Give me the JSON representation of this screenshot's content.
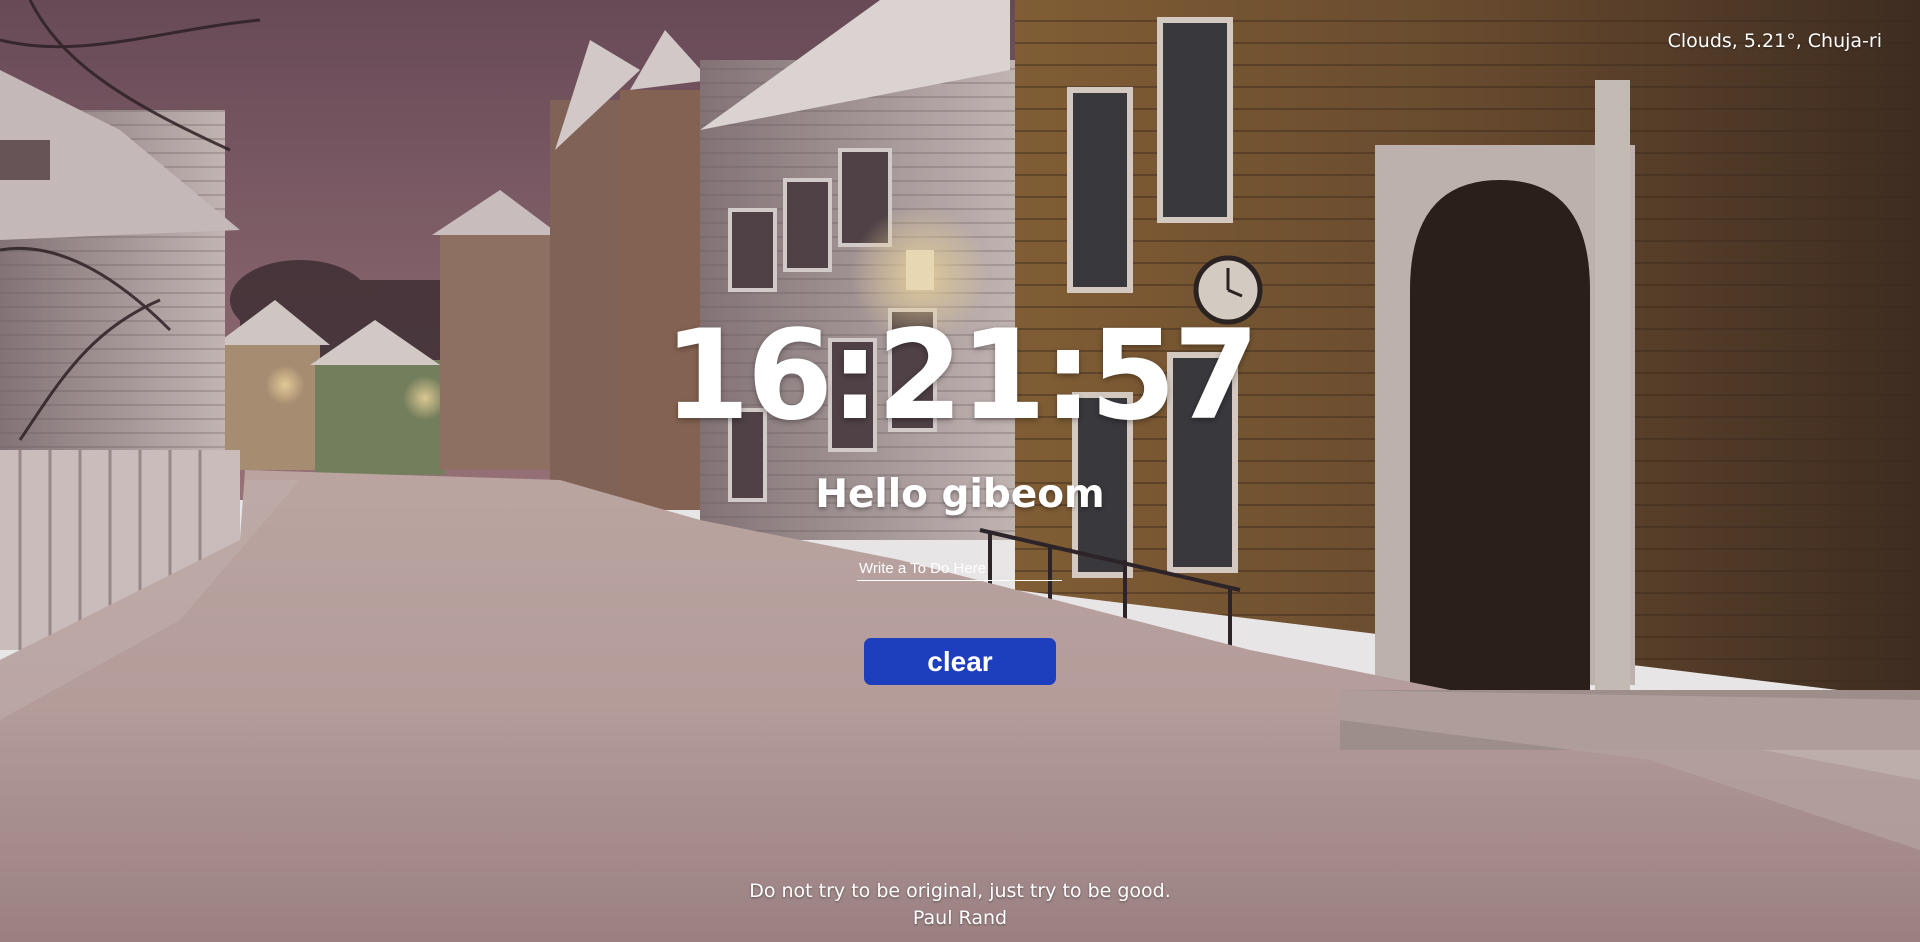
{
  "weather": {
    "text": "Clouds, 5.21°, Chuja-ri"
  },
  "clock": {
    "time": "16:21:57"
  },
  "greeting": {
    "text": "Hello gibeom"
  },
  "todo": {
    "placeholder": "Write a To Do Here",
    "value": ""
  },
  "clear_button": {
    "label": "clear"
  },
  "quote": {
    "text": "Do not try to be original, just try to be good.",
    "author": "Paul Rand"
  },
  "colors": {
    "button": "#1d3fbd",
    "text": "#ffffff",
    "sky": "#7d5a66",
    "snow": "#d9c4c0",
    "wood_house": "#7a5a35"
  },
  "background": {
    "scene": "snowy-street-night-photo"
  }
}
